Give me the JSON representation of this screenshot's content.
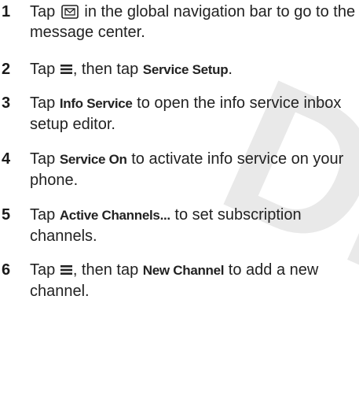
{
  "watermark": "DRA",
  "steps": [
    {
      "number": "1",
      "pre": "Tap",
      "icon": "message-center-icon",
      "post": "in the global navigation bar to go to the message center."
    },
    {
      "number": "2",
      "pre": "Tap",
      "icon": "menu-icon",
      "mid": ", then tap",
      "keyword": "Service Setup",
      "post": "."
    },
    {
      "number": "3",
      "pre": "Tap",
      "keyword": "Info Service",
      "post": "to open the info service inbox setup editor."
    },
    {
      "number": "4",
      "pre": "Tap",
      "keyword": "Service On",
      "post": "to activate info service on your phone."
    },
    {
      "number": "5",
      "pre": "Tap",
      "keyword": "Active Channels...",
      "post": "to set subscription channels."
    },
    {
      "number": "6",
      "pre": "Tap",
      "icon": "menu-icon",
      "mid": ", then tap",
      "keyword": "New Channel",
      "post": "to add a new channel."
    }
  ]
}
